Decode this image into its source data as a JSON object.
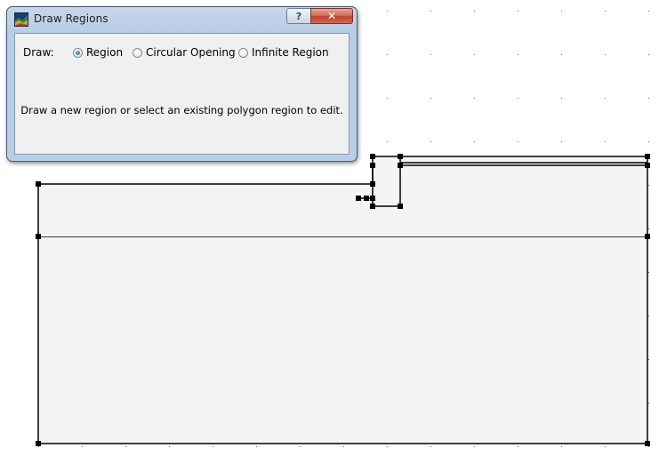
{
  "dialog": {
    "title": "Draw Regions",
    "help_label": "?",
    "close_label": "✕",
    "draw_label": "Draw:",
    "options": [
      {
        "label": "Region",
        "selected": true
      },
      {
        "label": "Circular Opening",
        "selected": false
      },
      {
        "label": "Infinite Region",
        "selected": false
      }
    ],
    "message": "Draw a new region or select an existing polygon region to edit."
  },
  "colors": {
    "region_fill": "#f4f4f4",
    "line": "#000000",
    "grid_dot": "#666666",
    "window_frame": "#b9cde6",
    "close_button": "#c0432b"
  }
}
